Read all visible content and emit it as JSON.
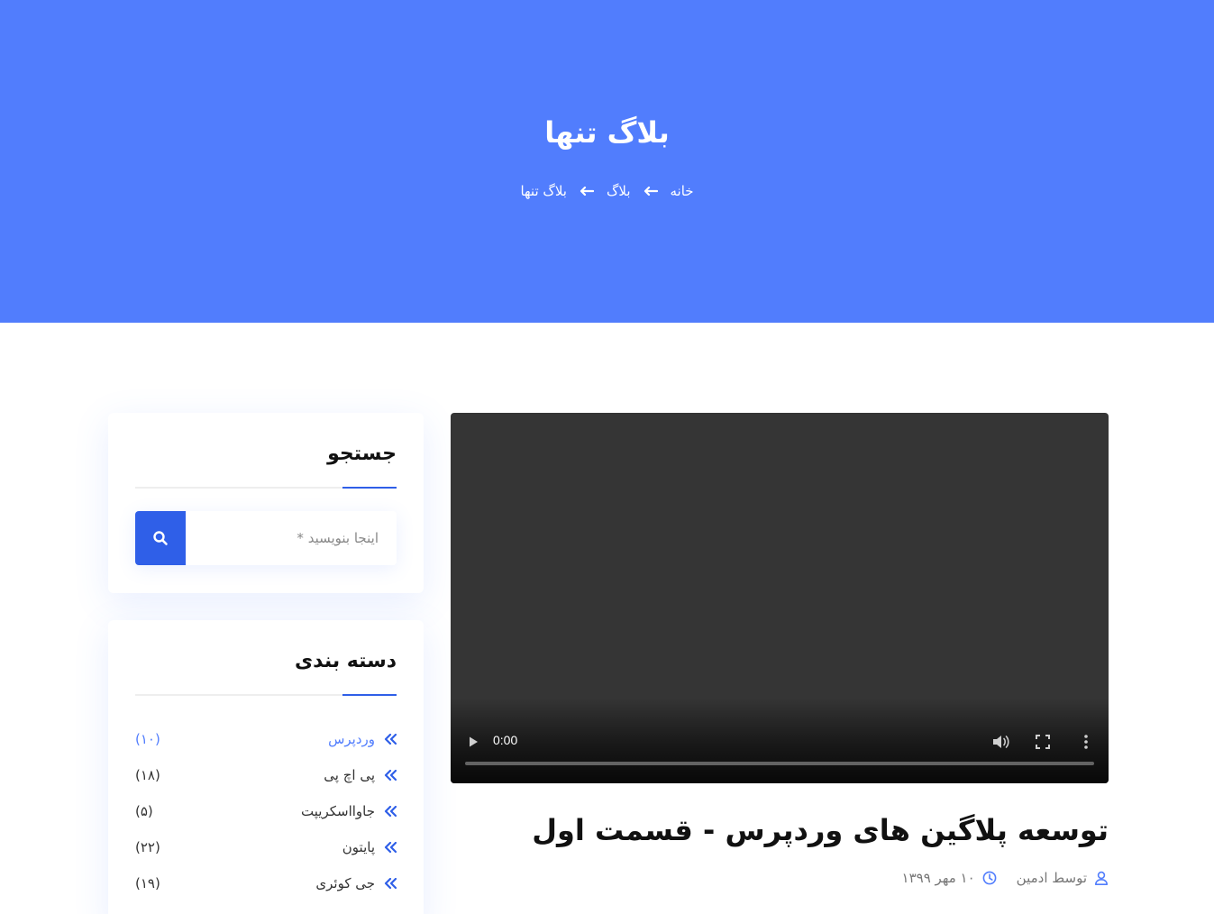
{
  "colors": {
    "brand": "#517dfd",
    "accent": "#2f5fe8"
  },
  "hero": {
    "title": "بلاگ تنها",
    "breadcrumb": [
      "خانه",
      "بلاگ",
      "بلاگ تنها"
    ]
  },
  "sidebar": {
    "search": {
      "title": "جستجو",
      "placeholder": "اینجا بنویسید *",
      "icon": "search-icon"
    },
    "categories": {
      "title": "دسته بندی",
      "items": [
        {
          "label": "وردپرس",
          "count": "(۱۰)",
          "active": true
        },
        {
          "label": "پی اچ پی",
          "count": "(۱۸)",
          "active": false
        },
        {
          "label": "جاوااسکریپت",
          "count": "(۵)",
          "active": false
        },
        {
          "label": "پایتون",
          "count": "(۲۲)",
          "active": false
        },
        {
          "label": "جی کوئری",
          "count": "(۱۹)",
          "active": false
        }
      ]
    }
  },
  "video": {
    "time": "0:00",
    "progress": 0
  },
  "post": {
    "title": "توسعه پلاگین های وردپرس - قسمت اول",
    "author": "توسط ادمین",
    "date": "۱۰ مهر ۱۳۹۹"
  }
}
